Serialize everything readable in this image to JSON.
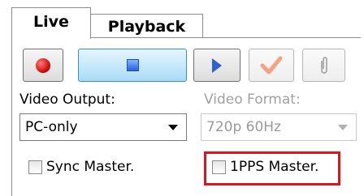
{
  "tabs": {
    "live": "Live",
    "playback": "Playback"
  },
  "controls": {
    "record": "record-icon",
    "stop": "stop-icon",
    "play": "play-icon",
    "confirm": "checkmark-icon",
    "attach": "paperclip-icon"
  },
  "video_output": {
    "label": "Video Output:",
    "value": "PC-only"
  },
  "video_format": {
    "label": "Video Format:",
    "value": "720p 60Hz"
  },
  "sync_master": {
    "label": "Sync Master."
  },
  "pps_master": {
    "label": "1PPS Master."
  },
  "colors": {
    "highlight": "#e0151b",
    "record": "#c80000",
    "stop_button": "#a9dbf6"
  }
}
